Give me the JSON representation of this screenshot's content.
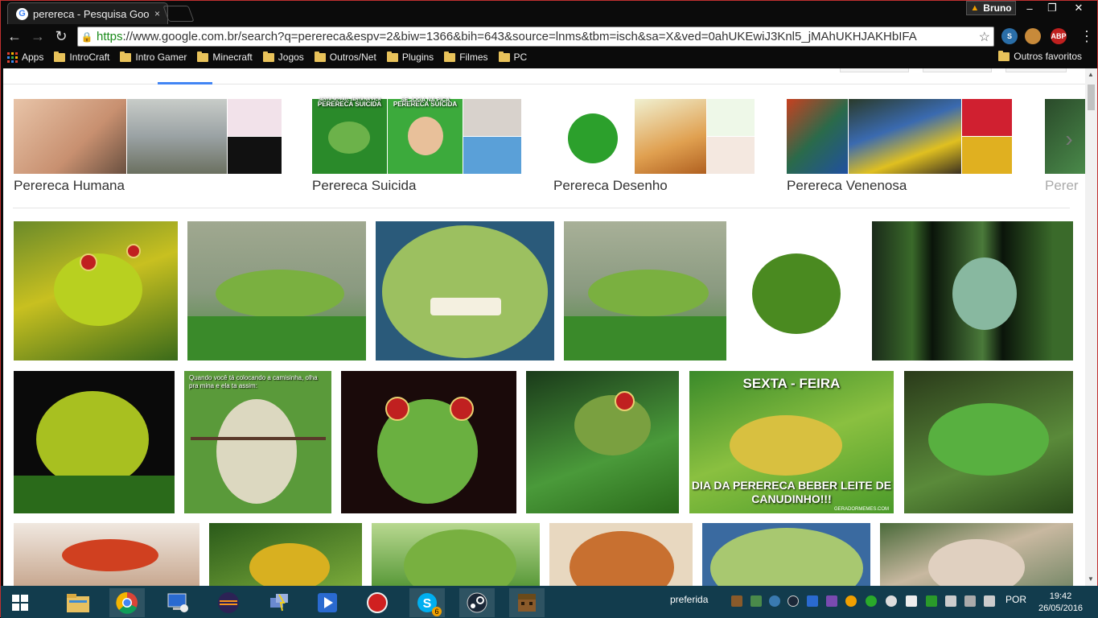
{
  "browser": {
    "tab_title": "perereca - Pesquisa Goog",
    "tab_close": "×",
    "profile_name": "Bruno",
    "win_min": "–",
    "win_max": "❐",
    "win_close": "✕",
    "url_scheme": "https",
    "url_rest": "://www.google.com.br/search?q=perereca&espv=2&biw=1366&bih=643&source=lnms&tbm=isch&sa=X&ved=0ahUKEwiJ3Knl5_jMAhUKHJAKHbIFA",
    "extensions": [
      "S",
      "",
      "ABP"
    ]
  },
  "bookmarks": {
    "apps_label": "Apps",
    "items": [
      "IntroCraft",
      "Intro Gamer",
      "Minecraft",
      "Jogos",
      "Outros/Net",
      "Plugins",
      "Filmes",
      "PC"
    ],
    "other": "Outros favoritos"
  },
  "related": [
    {
      "label": "Perereca Humana"
    },
    {
      "label": "Perereca Suicida"
    },
    {
      "label": "Perereca Desenho"
    },
    {
      "label": "Perereca Venenosa"
    },
    {
      "label": "Perer"
    }
  ],
  "meme_text": {
    "suicida_a": "PERERECA SUICIDA",
    "suicida_b": "PERERECA SUICIDA",
    "suicida_a_bottom": "SENTA NO PAU, SENTA NA PICA",
    "suicida_b_bottom": "SE JOGA NA PICA",
    "gym": "Quando você tá colocando a camisinha, olha pra mina e ela ta assim:",
    "sexta_top": "SEXTA - FEIRA",
    "sexta_bottom": "DIA DA PERERECA BEBER LEITE DE CANUDINHO!!!",
    "sexta_watermark": "GERADORMEMES.COM"
  },
  "taskbar": {
    "tray_label": "preferida",
    "lang": "POR",
    "time": "19:42",
    "date": "26/05/2016",
    "skype_badge": "6"
  },
  "colors": {
    "accent": "#4285f4",
    "taskbar": "#123c4d",
    "frame": "#c03030"
  }
}
